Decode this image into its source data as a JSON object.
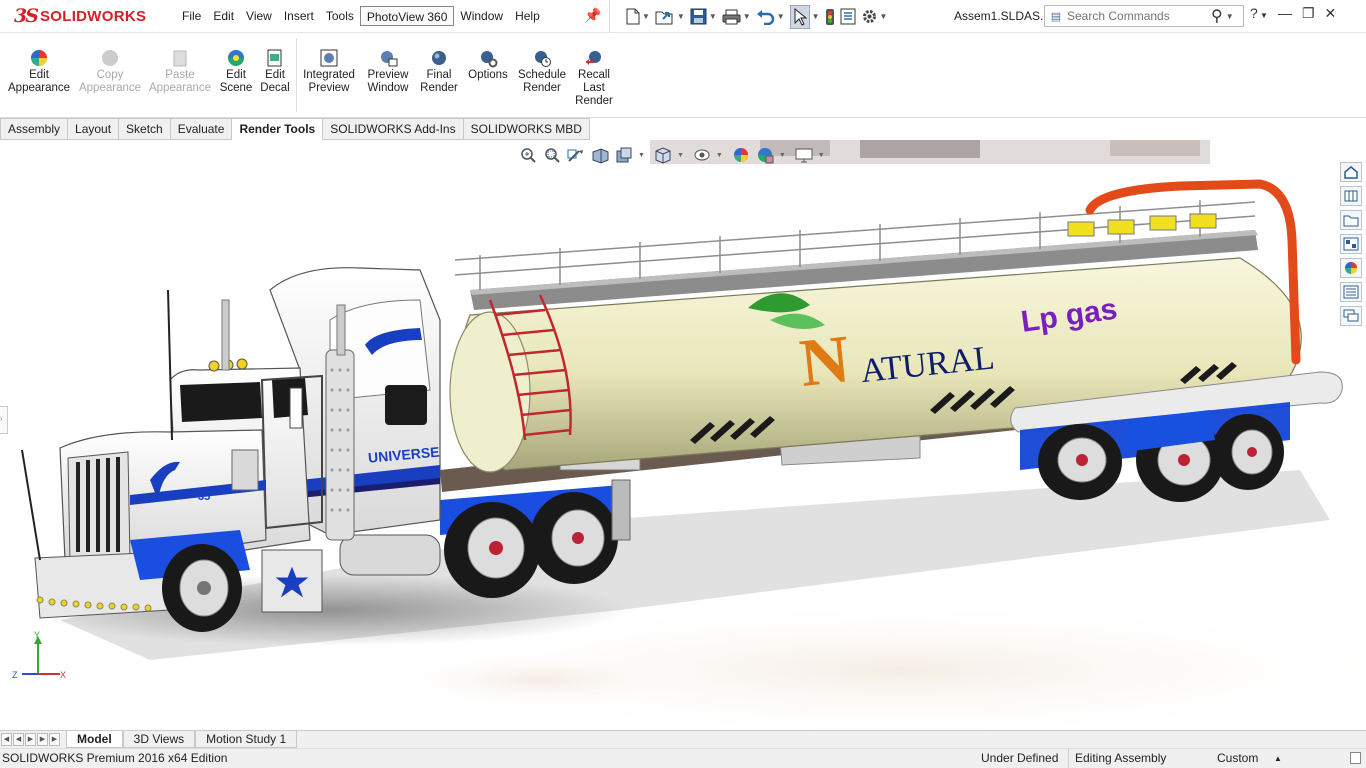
{
  "app": {
    "brand": "SOLIDWORKS",
    "document_title": "Assem1.SLDAS..."
  },
  "menu": [
    "File",
    "Edit",
    "View",
    "Insert",
    "Tools",
    "PhotoView 360",
    "Window",
    "Help"
  ],
  "search": {
    "placeholder": "Search Commands"
  },
  "quick_access_icons": [
    "new-document-icon",
    "open-folder-icon",
    "save-icon",
    "print-icon",
    "undo-icon",
    "select-pointer-icon",
    "rebuild-traffic-light-icon",
    "file-properties-icon",
    "options-gear-icon"
  ],
  "ribbon": {
    "buttons": [
      {
        "label1": "Edit",
        "label2": "Appearance",
        "enabled": true
      },
      {
        "label1": "Copy",
        "label2": "Appearance",
        "enabled": false
      },
      {
        "label1": "Paste",
        "label2": "Appearance",
        "enabled": false
      },
      {
        "label1": "Edit",
        "label2": "Scene",
        "enabled": true
      },
      {
        "label1": "Edit",
        "label2": "Decal",
        "enabled": true
      },
      {
        "label1": "Integrated",
        "label2": "Preview",
        "enabled": true
      },
      {
        "label1": "Preview",
        "label2": "Window",
        "enabled": true
      },
      {
        "label1": "Final",
        "label2": "Render",
        "enabled": true
      },
      {
        "label1": "Options",
        "label2": "",
        "enabled": true
      },
      {
        "label1": "Schedule",
        "label2": "Render",
        "enabled": true
      },
      {
        "label1": "Recall",
        "label2": "Last",
        "label3": "Render",
        "enabled": true
      }
    ]
  },
  "command_tabs": [
    {
      "label": "Assembly",
      "active": false
    },
    {
      "label": "Layout",
      "active": false
    },
    {
      "label": "Sketch",
      "active": false
    },
    {
      "label": "Evaluate",
      "active": false
    },
    {
      "label": "Render Tools",
      "active": true
    },
    {
      "label": "SOLIDWORKS Add-Ins",
      "active": false
    },
    {
      "label": "SOLIDWORKS MBD",
      "active": false
    }
  ],
  "model_decals": {
    "tank_brand": "ATURAL",
    "tank_initial": "N",
    "tank_product": "Lp gas",
    "cab_text": "UNIVERSE",
    "cab_number": "35"
  },
  "triad": {
    "y": "Y",
    "x": "X",
    "z": "Z"
  },
  "bottom_tabs": [
    {
      "label": "Model",
      "active": true
    },
    {
      "label": "3D Views",
      "active": false
    },
    {
      "label": "Motion Study 1",
      "active": false
    }
  ],
  "status": {
    "edition": "SOLIDWORKS Premium 2016 x64 Edition",
    "definition": "Under Defined",
    "mode": "Editing Assembly",
    "units": "Custom"
  }
}
